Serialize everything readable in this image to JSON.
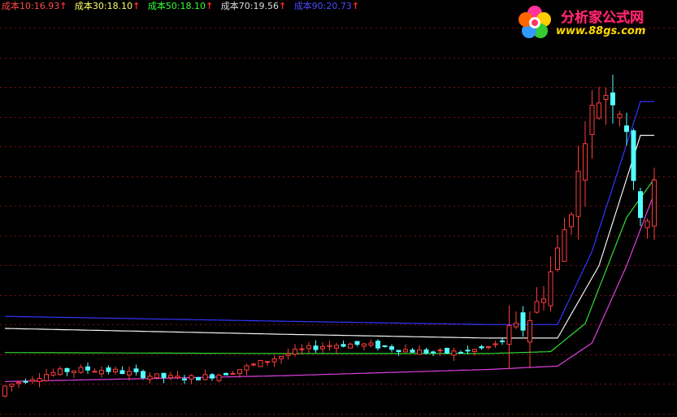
{
  "legend": [
    {
      "label": "成本10:",
      "value": "16.93",
      "arrow": "↑",
      "label_color": "#ff4a4a",
      "value_color": "#ff4a4a"
    },
    {
      "label": "成本30:",
      "value": "18.10",
      "arrow": "↑",
      "label_color": "#ffff66",
      "value_color": "#ffff66"
    },
    {
      "label": "成本50:",
      "value": "18.10",
      "arrow": "↑",
      "label_color": "#33ff33",
      "value_color": "#33ff33"
    },
    {
      "label": "成本70:",
      "value": "19.56",
      "arrow": "↑",
      "label_color": "#dddddd",
      "value_color": "#dddddd"
    },
    {
      "label": "成本90:",
      "value": "20.73",
      "arrow": "↑",
      "label_color": "#4b4bff",
      "value_color": "#4b4bff"
    }
  ],
  "logo": {
    "brand": "分析家公式网",
    "url": "www.88gs.com",
    "icon": "flower-logo-icon"
  },
  "colors": {
    "background": "#000000",
    "grid": "#7a1010",
    "up_candle": "#ff3c3c",
    "down_candle": "#54ffff",
    "cost90": "#3535ff",
    "cost70": "#f2f2f2",
    "cost50": "#33dd33",
    "cost10": "#e040e0"
  },
  "chart_data": {
    "type": "line",
    "grid": true,
    "ylim": [
      14.2,
      22.4
    ],
    "candles_summary": {
      "count": 95,
      "start_price": 14.5,
      "flat_end_price": 15.6,
      "peak_high": 21.3,
      "last_close": 18.8
    },
    "series": [
      {
        "name": "成本90",
        "color": "#3535ff",
        "points": [
          [
            0,
            16.15
          ],
          [
            40,
            16.05
          ],
          [
            70,
            15.98
          ],
          [
            80,
            15.98
          ],
          [
            85,
            17.5
          ],
          [
            92,
            20.6
          ],
          [
            94,
            20.6
          ]
        ]
      },
      {
        "name": "成本70",
        "color": "#f2f2f2",
        "points": [
          [
            0,
            15.9
          ],
          [
            40,
            15.78
          ],
          [
            70,
            15.7
          ],
          [
            80,
            15.7
          ],
          [
            86,
            17.2
          ],
          [
            92,
            19.9
          ],
          [
            94,
            19.9
          ]
        ]
      },
      {
        "name": "成本50",
        "color": "#33dd33",
        "points": [
          [
            0,
            15.4
          ],
          [
            40,
            15.38
          ],
          [
            70,
            15.38
          ],
          [
            79,
            15.42
          ],
          [
            84,
            16.0
          ],
          [
            90,
            18.2
          ],
          [
            94,
            19.0
          ]
        ]
      },
      {
        "name": "成本10",
        "color": "#e040e0",
        "points": [
          [
            0,
            14.8
          ],
          [
            40,
            14.92
          ],
          [
            70,
            15.05
          ],
          [
            80,
            15.12
          ],
          [
            85,
            15.6
          ],
          [
            90,
            17.2
          ],
          [
            94,
            18.7
          ]
        ]
      }
    ]
  }
}
